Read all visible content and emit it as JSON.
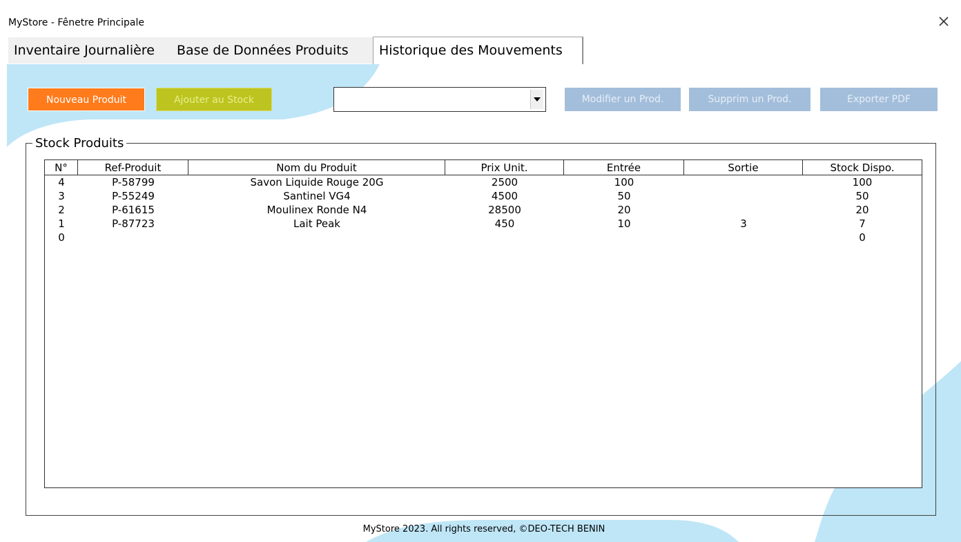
{
  "window": {
    "title": "MyStore - Fênetre Principale"
  },
  "tabs": [
    {
      "label": "Inventaire Journalière"
    },
    {
      "label": "Base de Données Produits"
    },
    {
      "label": "Historique des Mouvements"
    }
  ],
  "toolbar": {
    "new_label": "Nouveau Produit",
    "add_label": "Ajouter au Stock",
    "product_select_value": "",
    "modify_label": "Modifier un Prod.",
    "delete_label": "Supprim un Prod.",
    "export_label": "Exporter PDF"
  },
  "stock": {
    "group_label": "Stock Produits",
    "columns": [
      "N°",
      "Ref-Produit",
      "Nom du Produit",
      "Prix Unit.",
      "Entrée",
      "Sortie",
      "Stock Dispo."
    ],
    "rows": [
      [
        "4",
        "P-58799",
        "Savon Liquide Rouge 20G",
        "2500",
        "100",
        "",
        "100"
      ],
      [
        "3",
        "P-55249",
        "Santinel VG4",
        "4500",
        "50",
        "",
        "50"
      ],
      [
        "2",
        "P-61615",
        "Moulinex Ronde N4",
        "28500",
        "20",
        "",
        "20"
      ],
      [
        "1",
        "P-87723",
        "Lait Peak",
        "450",
        "10",
        "3",
        "7"
      ],
      [
        "0",
        "",
        "",
        "",
        "",
        "",
        "0"
      ]
    ]
  },
  "footer": {
    "text": "MyStore 2023. All rights reserved, ©DEO-TECH BENIN"
  },
  "colors": {
    "new_button": "#ff7b1c",
    "add_button": "#bdc420",
    "disabled_button": "#a3bedb",
    "background_wave": "#bfe6f7"
  }
}
